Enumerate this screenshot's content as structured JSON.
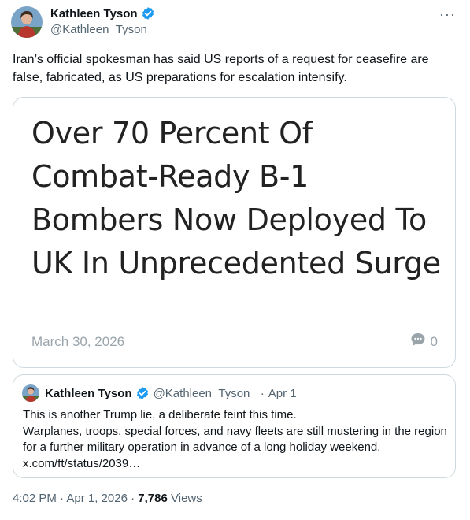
{
  "author": {
    "name": "Kathleen Tyson",
    "handle": "@Kathleen_Tyson_"
  },
  "tweet": {
    "text": "Iran’s official spokesman has said US reports of a request for ceasefire are false, fabricated, as US preparations for escalation intensify."
  },
  "card": {
    "headline": "Over 70 Percent Of Combat-Ready B-1 Bombers Now Deployed To UK In Unprecedented Surge",
    "date": "March 30, 2026",
    "comment_count": "0"
  },
  "quote": {
    "name": "Kathleen Tyson",
    "handle": "@Kathleen_Tyson_",
    "separator": "·",
    "date": "Apr 1",
    "line1": "This is another Trump lie, a deliberate feint this time.",
    "line2": "Warplanes, troops, special forces, and navy fleets are still mustering in the region for a further military operation in advance of a long holiday weekend. x.com/ft/status/2039…"
  },
  "meta": {
    "time": "4:02 PM",
    "date": "Apr 1, 2026",
    "views_count": "7,786",
    "views_label": "Views",
    "separator": "·"
  },
  "more_label": "···",
  "colors": {
    "verified": "#1d9bf0",
    "secondary_text": "#536471",
    "border": "#cfd9de"
  }
}
